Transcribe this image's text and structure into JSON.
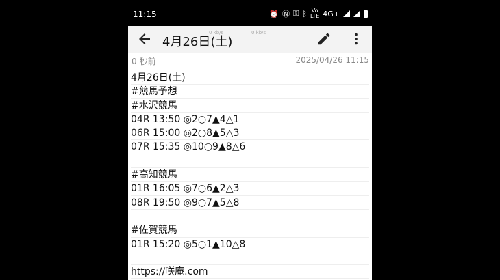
{
  "status_bar": {
    "time": "11:15",
    "network_label": "4G+",
    "icons": [
      "alarm-icon",
      "nfc-icon",
      "key-icon",
      "bluetooth-icon",
      "volte-icon",
      "signal-icon",
      "battery-icon"
    ]
  },
  "app_bar": {
    "title": "4月26日(土)",
    "watermark_1": "0 kb/s",
    "watermark_2": "0 kb/s"
  },
  "meta": {
    "edited_ago": "0 秒前",
    "timestamp": "2025/04/26 11:15"
  },
  "note_lines": [
    "4月26日(土)",
    "#競馬予想",
    "#水沢競馬",
    "04R 13:50 ◎2○7▲4△1",
    "06R 15:00 ◎2○8▲5△3",
    "07R 15:35 ◎10○9▲8△6",
    "",
    "#高知競馬",
    "01R 16:05 ◎7○6▲2△3",
    "08R 19:50 ◎9○7▲5△8",
    "",
    "#佐賀競馬",
    "01R 15:20 ◎5○1▲10△8",
    "",
    "https://咲庵.com"
  ]
}
